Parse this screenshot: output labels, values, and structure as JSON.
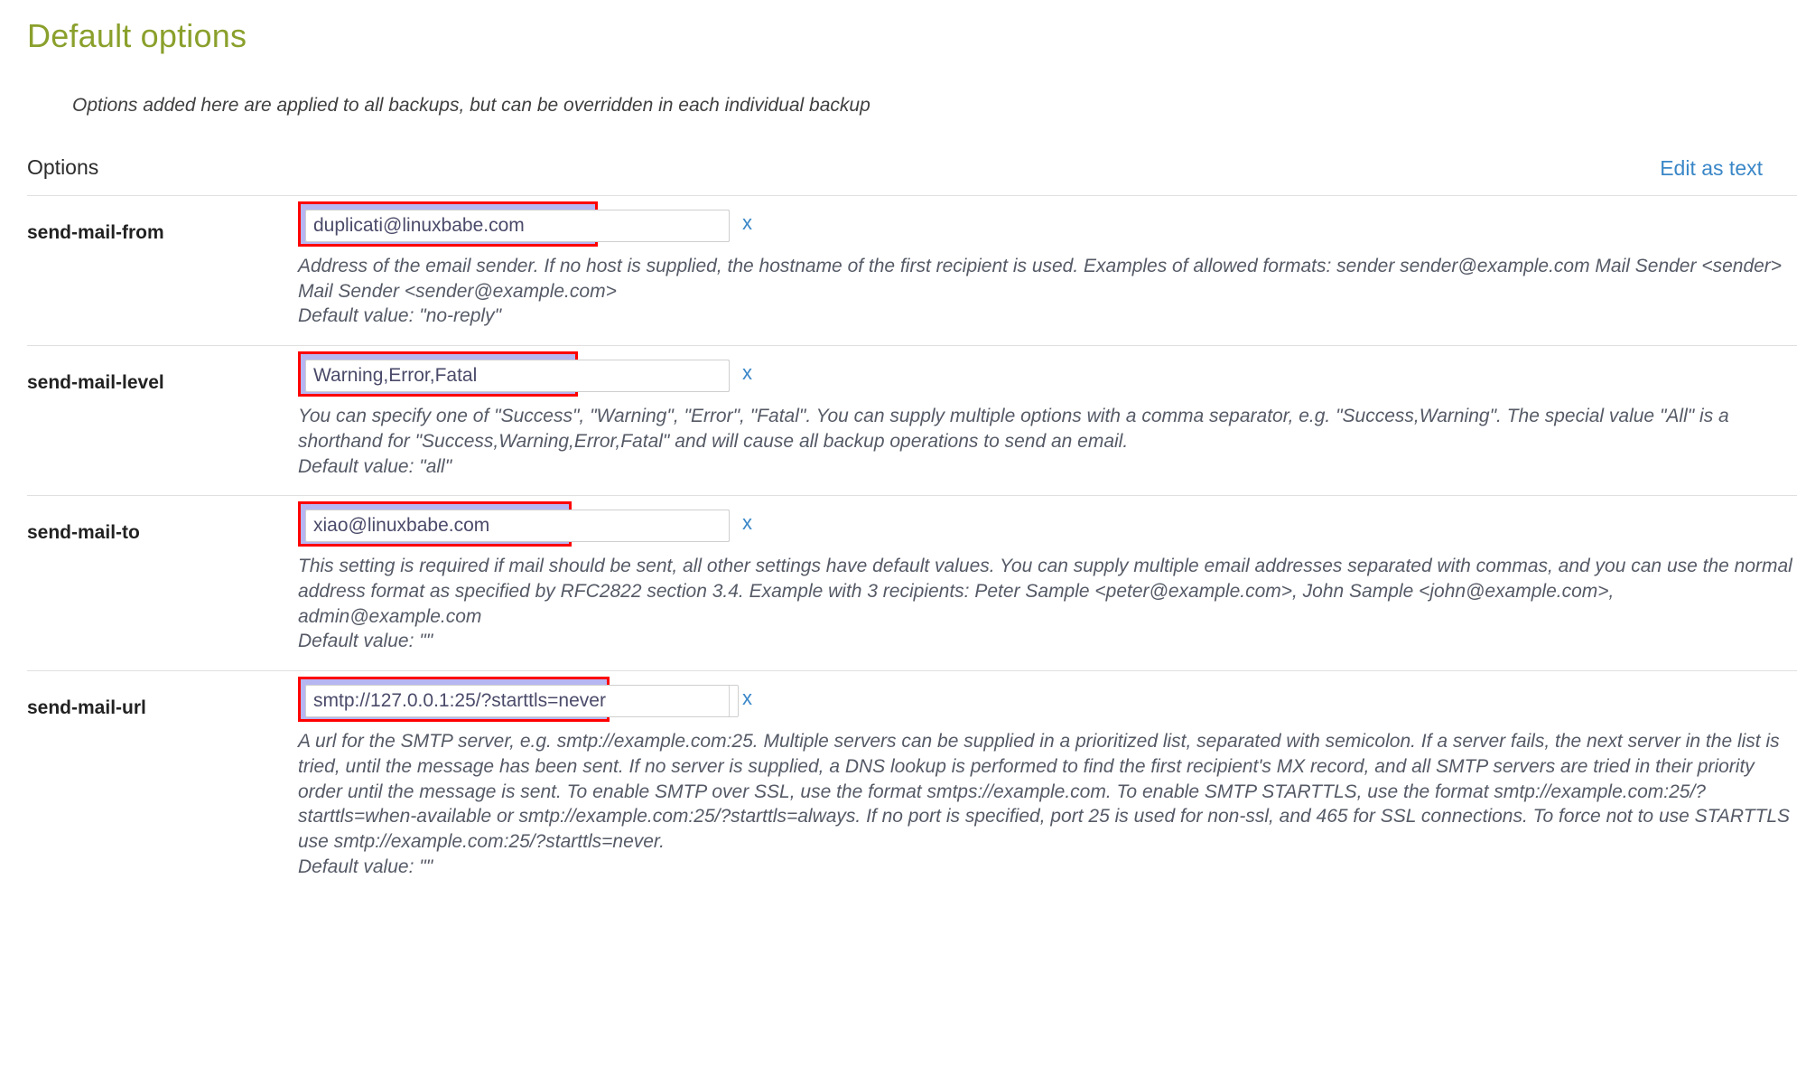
{
  "header": {
    "title": "Default options",
    "subtitle": "Options added here are applied to all backups, but can be overridden in each individual backup"
  },
  "options_bar": {
    "label": "Options",
    "edit_as_text": "Edit as text"
  },
  "icons": {
    "remove": "x"
  },
  "colors": {
    "title_green": "#8aa02c",
    "link_blue": "#3a87c8",
    "selection_purple": "#b6b6f2",
    "annotation_red": "#ff0000",
    "description_text": "#555a66",
    "divider": "#e0e0e0"
  },
  "options": [
    {
      "key": "send-mail-from",
      "value": "duplicati@linuxbabe.com",
      "placeholder": "",
      "remove_label": "x",
      "description": "Address of the email sender. If no host is supplied, the hostname of the first recipient is used. Examples of allowed formats:  sender sender@example.com Mail Sender <sender> Mail Sender <sender@example.com>",
      "default_value": "Default value: \"no-reply\""
    },
    {
      "key": "send-mail-level",
      "value": "Warning,Error,Fatal",
      "placeholder": "",
      "remove_label": "x",
      "description": "You can specify one of \"Success\", \"Warning\", \"Error\", \"Fatal\". You can supply multiple options with a comma separator, e.g. \"Success,Warning\". The special value \"All\" is a shorthand for \"Success,Warning,Error,Fatal\" and will cause all backup operations to send an email.",
      "default_value": "Default value: \"all\""
    },
    {
      "key": "send-mail-to",
      "value": "xiao@linuxbabe.com",
      "placeholder": "",
      "remove_label": "x",
      "description": "This setting is required if mail should be sent, all other settings have default values. You can supply multiple email addresses separated with commas, and you can use the normal address format as specified by RFC2822 section 3.4. Example with 3 recipients:   Peter Sample <peter@example.com>, John Sample <john@example.com>, admin@example.com",
      "default_value": "Default value: \"\""
    },
    {
      "key": "send-mail-url",
      "value": "smtp://127.0.0.1:25/?starttls=never",
      "placeholder": "",
      "remove_label": "x",
      "description": "A url for the SMTP server, e.g. smtp://example.com:25. Multiple servers can be supplied in a prioritized list, separated with semicolon. If a server fails, the next server in the list is tried, until the message has been sent. If no server is supplied, a DNS lookup is performed to find the first recipient's MX record, and all SMTP servers are tried in their priority order until the message is sent.  To enable SMTP over SSL, use the format smtps://example.com. To enable SMTP STARTTLS, use the format smtp://example.com:25/?starttls=when-available or smtp://example.com:25/?starttls=always. If no port is specified, port 25 is used for non-ssl, and 465 for SSL connections. To force not to use STARTTLS use smtp://example.com:25/?starttls=never.",
      "default_value": "Default value: \"\""
    }
  ]
}
